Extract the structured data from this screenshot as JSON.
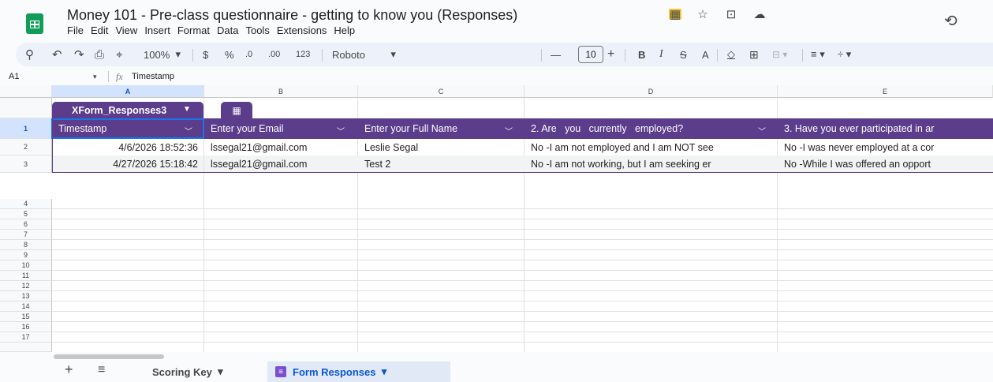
{
  "app": {
    "title": "Money 101 - Pre-class questionnaire - getting to  know you (Responses)",
    "menu": [
      "File",
      "Edit",
      "View",
      "Insert",
      "Format",
      "Data",
      "Tools",
      "Extensions",
      "Help"
    ]
  },
  "toolbar": {
    "zoom": "100%",
    "currency": "$",
    "percent": "%",
    "dec_decrease": ".0",
    "dec_increase": ".00",
    "number_format": "123",
    "font": "Roboto",
    "font_size": "10",
    "minus": "—",
    "plus": "+",
    "bold": "B",
    "italic": "I",
    "text_color": "A"
  },
  "formula_bar": {
    "cell_ref": "A1",
    "fx": "fx",
    "value": "Timestamp"
  },
  "grid": {
    "columns": [
      "A",
      "B",
      "C",
      "D",
      "E"
    ],
    "rows": [
      "1",
      "2",
      "3",
      "4",
      "5",
      "6",
      "7",
      "8",
      "9",
      "10",
      "11",
      "12",
      "13",
      "14",
      "15",
      "16",
      "17"
    ]
  },
  "table": {
    "name": "XForm_Responses3",
    "headers": [
      "Timestamp",
      "Enter your Email",
      "Enter your Full Name",
      "2. Are   you   currently   employed?",
      "3. Have you ever participated in ar"
    ],
    "rows": [
      [
        "4/6/2026 18:52:36",
        "lssegal21@gmail.com",
        "Leslie Segal",
        "No -I am not employed and I am NOT see",
        "No -I was never employed at a cor"
      ],
      [
        "4/27/2026 15:18:42",
        "lssegal21@gmail.com",
        "Test 2",
        "No -I am not working, but I am seeking er",
        "No -While I was offered an opport"
      ]
    ]
  },
  "sheets": {
    "tabs": [
      "Scoring Key",
      "Form Responses"
    ],
    "active": "Form Responses"
  },
  "colors": {
    "table_header": "#5b3d8c",
    "selection": "#1a73e8",
    "active_tab": "#0b57d0"
  }
}
